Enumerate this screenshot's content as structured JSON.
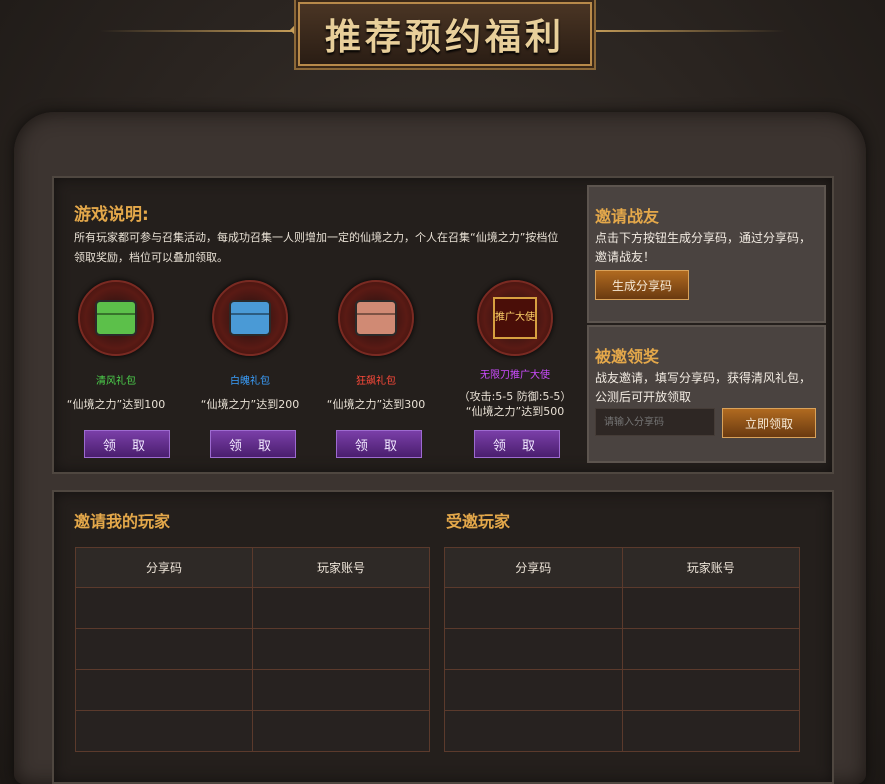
{
  "header": {
    "title": "推荐预约福利"
  },
  "game_info": {
    "title": "游戏说明:",
    "description": "所有玩家都可参与召集活动，每成功召集一人则增加一定的仙境之力，个人在召集“仙境之力”按档位领取奖励，档位可以叠加领取。"
  },
  "rewards": [
    {
      "name": "清风礼包",
      "name_color": "#4cd24c",
      "requirement": "“仙境之力”达到100",
      "claim_label": "领 取",
      "chest_color": "#5cc04a"
    },
    {
      "name": "白魄礼包",
      "name_color": "#3aa0ff",
      "requirement": "“仙境之力”达到200",
      "claim_label": "领 取",
      "chest_color": "#4a9ad6"
    },
    {
      "name": "狂飙礼包",
      "name_color": "#ff4a3a",
      "requirement": "“仙境之力”达到300",
      "claim_label": "领 取",
      "chest_color": "#d08a74"
    },
    {
      "name": "无限刀推广大使",
      "name_color": "#cc4cff",
      "requirement": "（攻击:5-5 防御:5-5）",
      "requirement2": "“仙境之力”达到500",
      "claim_label": "领 取",
      "badge_text": "推广大使"
    }
  ],
  "invite_box": {
    "title": "邀请战友",
    "text": "点击下方按钮生成分享码，通过分享码，邀请战友！",
    "button_label": "生成分享码"
  },
  "invited_box": {
    "title": "被邀领奖",
    "text": "战友邀请，填写分享码，获得清风礼包，公测后可开放领取",
    "input_placeholder": "请输入分享码",
    "button_label": "立即领取"
  },
  "inviters": {
    "title": "邀请我的玩家",
    "columns": [
      "分享码",
      "玩家账号"
    ],
    "rows": [
      [
        "",
        ""
      ],
      [
        "",
        ""
      ],
      [
        "",
        ""
      ],
      [
        "",
        ""
      ]
    ]
  },
  "invitees": {
    "title": "受邀玩家",
    "columns": [
      "分享码",
      "玩家账号"
    ],
    "rows": [
      [
        "",
        ""
      ],
      [
        "",
        ""
      ],
      [
        "",
        ""
      ],
      [
        "",
        ""
      ]
    ]
  },
  "colors": {
    "accent_gold": "#e4a84a",
    "claim_purple": "#7a3fa8",
    "frame_brown": "#3c3430"
  }
}
